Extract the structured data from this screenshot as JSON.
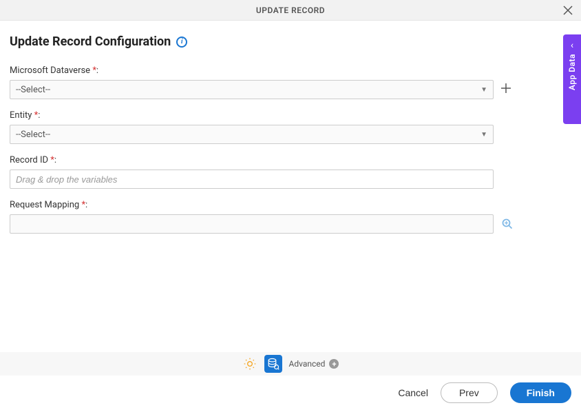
{
  "header": {
    "title": "UPDATE RECORD"
  },
  "page": {
    "title": "Update Record Configuration"
  },
  "form": {
    "dataverse": {
      "label": "Microsoft Dataverse",
      "value": "--Select--"
    },
    "entity": {
      "label": "Entity",
      "value": "--Select--"
    },
    "recordId": {
      "label": "Record ID",
      "placeholder": "Drag & drop the variables"
    },
    "requestMapping": {
      "label": "Request Mapping"
    }
  },
  "bottomBar": {
    "advanced": "Advanced"
  },
  "footer": {
    "cancel": "Cancel",
    "prev": "Prev",
    "finish": "Finish"
  },
  "sideTab": {
    "label": "App Data"
  },
  "required_marker": "*",
  "colon": ":"
}
